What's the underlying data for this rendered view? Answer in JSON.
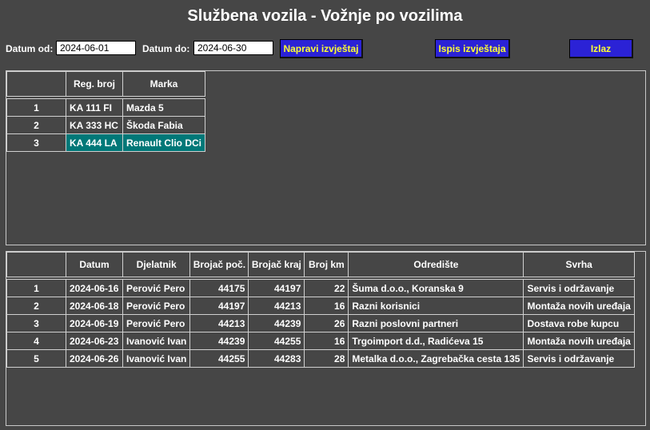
{
  "title": "Službena vozila - Vožnje po vozilima",
  "filter": {
    "date_from_label": "Datum od:",
    "date_from_value": "2024-06-01",
    "date_to_label": "Datum do:",
    "date_to_value": "2024-06-30"
  },
  "buttons": {
    "make_report": "Napravi izvještaj",
    "print_report": "Ispis izvještaja",
    "exit": "Izlaz"
  },
  "colors": {
    "background": "#464646",
    "button": "#2b22d6",
    "button_text": "#ffff33",
    "selected_row": "#007878"
  },
  "vehicles": {
    "headers": [
      "",
      "Reg. broj",
      "Marka"
    ],
    "rows": [
      {
        "no": "1",
        "reg": "KA 111 FI",
        "make": "Mazda 5"
      },
      {
        "no": "2",
        "reg": "KA 333 HC",
        "make": "Škoda Fabia"
      },
      {
        "no": "3",
        "reg": "KA 444 LA",
        "make": "Renault Clio DCi"
      }
    ],
    "selected_index": 2
  },
  "trips": {
    "headers": [
      "",
      "Datum",
      "Djelatnik",
      "Brojač poč.",
      "Brojač kraj",
      "Broj km",
      "Odredište",
      "Svrha"
    ],
    "rows": [
      {
        "no": "1",
        "date": "2024-06-16",
        "employee": "Perović Pero",
        "start": "44175",
        "end": "44197",
        "km": "22",
        "destination": "Šuma d.o.o., Koranska 9",
        "purpose": "Servis i održavanje"
      },
      {
        "no": "2",
        "date": "2024-06-18",
        "employee": "Perović Pero",
        "start": "44197",
        "end": "44213",
        "km": "16",
        "destination": "Razni korisnici",
        "purpose": "Montaža novih uređaja"
      },
      {
        "no": "3",
        "date": "2024-06-19",
        "employee": "Perović Pero",
        "start": "44213",
        "end": "44239",
        "km": "26",
        "destination": "Razni poslovni partneri",
        "purpose": "Dostava robe kupcu"
      },
      {
        "no": "4",
        "date": "2024-06-23",
        "employee": "Ivanović Ivan",
        "start": "44239",
        "end": "44255",
        "km": "16",
        "destination": "Trgoimport d.d., Radićeva 15",
        "purpose": "Montaža novih uređaja"
      },
      {
        "no": "5",
        "date": "2024-06-26",
        "employee": "Ivanović Ivan",
        "start": "44255",
        "end": "44283",
        "km": "28",
        "destination": "Metalka d.o.o., Zagrebačka cesta 135",
        "purpose": "Servis i održavanje"
      }
    ]
  }
}
